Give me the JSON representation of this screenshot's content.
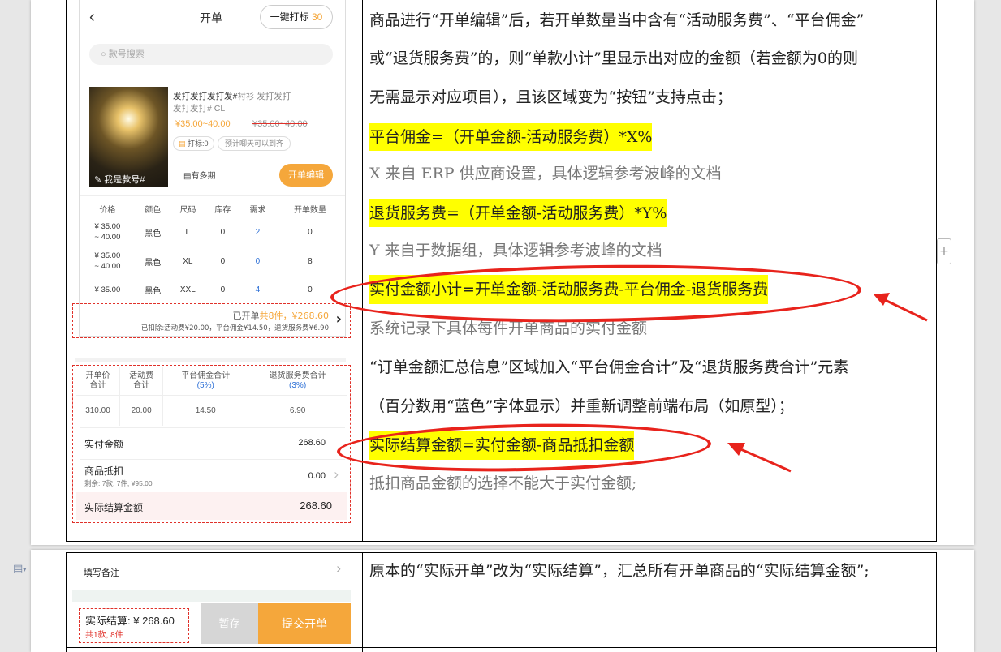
{
  "app": {
    "title": "开单",
    "quick_mark_label": "一键打标",
    "quick_mark_count": "30",
    "search_placeholder": "款号搜索"
  },
  "product": {
    "name": "发打发打发打发#",
    "name_tail": "衬衫 发打发打",
    "name_line2": "发打发打#",
    "code": "CL",
    "price": "¥35.00~40.00",
    "old_price": "¥35.00~40.00",
    "mark_tag": "打标:0",
    "expect_tag": "预计唧天可以到齐",
    "image_caption": "我是款号#",
    "multi_period": "有多期",
    "edit_button": "开单编辑"
  },
  "sku_table": {
    "headers": [
      "价格",
      "颜色",
      "尺码",
      "库存",
      "需求",
      "开单数量"
    ],
    "rows": [
      {
        "price": [
          "¥ 35.00",
          "~ 40.00"
        ],
        "color": "黑色",
        "size": "L",
        "stock": "0",
        "demand": "2",
        "qty": "0"
      },
      {
        "price": [
          "¥ 35.00",
          "~ 40.00"
        ],
        "color": "黑色",
        "size": "XL",
        "stock": "0",
        "demand": "0",
        "qty": "8"
      },
      {
        "price": [
          "¥ 35.00",
          ""
        ],
        "color": "黑色",
        "size": "XXL",
        "stock": "0",
        "demand": "4",
        "qty": "0"
      }
    ]
  },
  "subtotal": {
    "opened": "已开单",
    "count": "共8件，",
    "amount": "¥268.60",
    "deduction": "已扣除:活动费¥20.00，平台佣金¥14.50，退货服务费¥6.90"
  },
  "summary": {
    "headers": [
      [
        "开单价",
        "合计",
        ""
      ],
      [
        "活动费",
        "合计",
        ""
      ],
      [
        "平台佣金合计",
        "",
        "(5%)"
      ],
      [
        "退货服务费合计",
        "",
        "(3%)"
      ]
    ],
    "values": [
      "310.00",
      "20.00",
      "14.50",
      "6.90"
    ],
    "paid_label": "实付金额",
    "paid_value": "268.60",
    "offset_label": "商品抵扣",
    "offset_sub": "剩余: 7款, 7件, ¥95.00",
    "offset_value": "0.00",
    "settle_label": "实际结算金额",
    "settle_value": "268.60"
  },
  "footer": {
    "remark": "填写备注",
    "settle_text": "实际结算: ¥ 268.60",
    "settle_sub": "共1款, 8件",
    "save_button": "暂存",
    "submit_button": "提交开单"
  },
  "doc": {
    "p1": "商品进行“开单编辑”后，若开单数量当中含有“活动服务费”、“平台佣金”",
    "p2": "或“退货服务费”的，则“单款小计”里显示出对应的金额（若金额为0的则",
    "p3": "无需显示对应项目），且该区域变为“按钮”支持点击；",
    "f1": "平台佣金=（开单金额-活动服务费）*X%",
    "n1": "X 来自 ERP 供应商设置，具体逻辑参考波峰的文档",
    "f2": "退货服务费=（开单金额-活动服务费）*Y%",
    "n2": "Y 来自于数据组，具体逻辑参考波峰的文档",
    "f3": "实付金额小计=开单金额-活动服务费-平台佣金-退货服务费",
    "n3": "系统记录下具体每件开单商品的实付金额",
    "q1": "“订单金额汇总信息”区域加入“平台佣金合计”及“退货服务费合计”元素",
    "q2": "（百分数用“蓝色”字体显示）并重新调整前端布局（如原型）；",
    "f4": "实际结算金额=实付金额-商品抵扣金额",
    "n4": "抵扣商品金额的选择不能大于实付金额;",
    "r1": "原本的“实际开单”改为“实际结算”，汇总所有开单商品的“实际结算金额”;"
  },
  "colors": {
    "accent": "#f5a73b",
    "red": "#e8231c",
    "blue": "#2c6fd6",
    "highlight": "#ffff00"
  }
}
